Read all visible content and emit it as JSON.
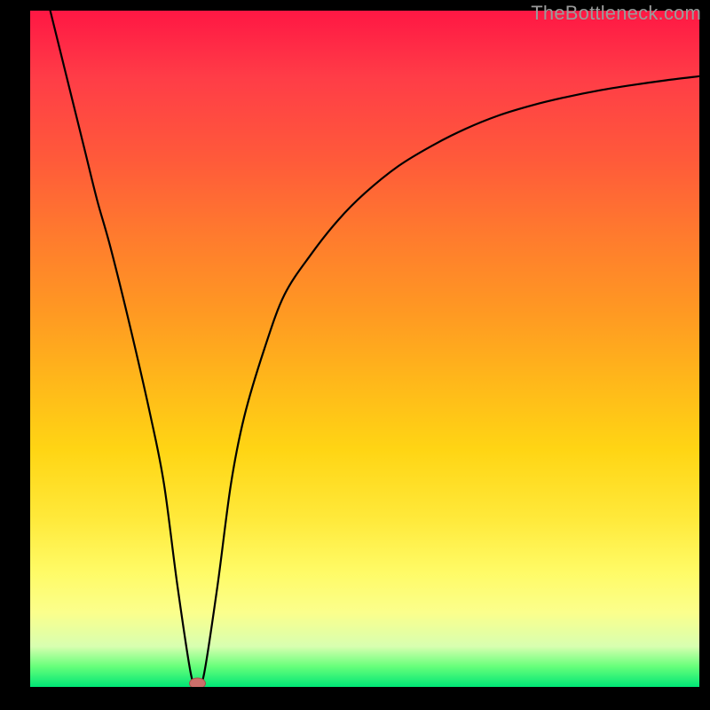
{
  "watermark": {
    "text": "TheBottleneck.com"
  },
  "chart_data": {
    "type": "line",
    "title": "",
    "xlabel": "",
    "ylabel": "",
    "xlim": [
      0,
      100
    ],
    "ylim": [
      0,
      100
    ],
    "series": [
      {
        "name": "curve",
        "x": [
          3,
          5,
          8,
          10,
          12,
          15,
          18,
          20,
          22,
          24,
          25,
          26,
          28,
          30,
          32,
          35,
          38,
          42,
          46,
          50,
          55,
          60,
          65,
          70,
          75,
          80,
          85,
          90,
          95,
          100
        ],
        "values": [
          100,
          92,
          80,
          72,
          65,
          53,
          40,
          30,
          15,
          2,
          0,
          2,
          15,
          30,
          40,
          50,
          58,
          64,
          69,
          73,
          77,
          80,
          82.5,
          84.5,
          86,
          87.2,
          88.2,
          89,
          89.7,
          90.3
        ]
      }
    ],
    "marker": {
      "x": 25,
      "y": 0
    },
    "grid": false,
    "legend": false
  }
}
